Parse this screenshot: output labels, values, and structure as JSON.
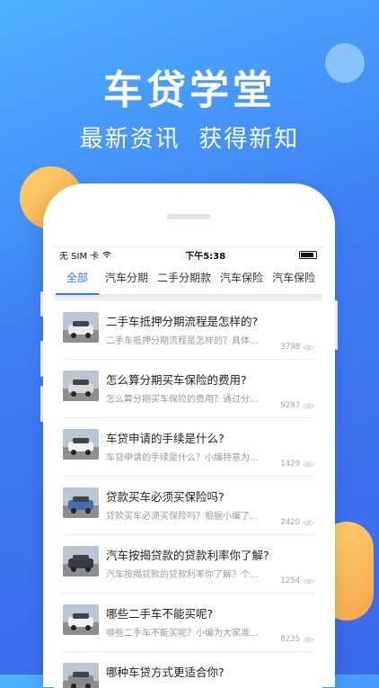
{
  "hero": {
    "title": "车贷学堂",
    "subtitle": "最新资讯  获得新知"
  },
  "status_bar": {
    "carrier": "无 SIM 卡",
    "time": "下午5:38"
  },
  "tabs": [
    {
      "label": "全部",
      "active": true
    },
    {
      "label": "汽车分期",
      "active": false
    },
    {
      "label": "二手分期款",
      "active": false
    },
    {
      "label": "汽车保险",
      "active": false
    },
    {
      "label": "汽车保险",
      "active": false
    }
  ],
  "articles": [
    {
      "title": "二手车抵押分期流程是怎样的?",
      "excerpt": "二手车抵押分期流程是怎样的？具体...",
      "views": "3798",
      "car_color": "#e9e9e9"
    },
    {
      "title": "怎么算分期买车保险的费用?",
      "excerpt": "怎么算分期买车保险的费用？通过分...",
      "views": "9297",
      "car_color": "#d9d9d9"
    },
    {
      "title": "车贷申请的手续是什么?",
      "excerpt": "车贷申请的手续是什么？小编特意为...",
      "views": "1429",
      "car_color": "#f2f2f2"
    },
    {
      "title": "贷款买车必须买保险吗?",
      "excerpt": "贷款买车必须买保险吗？根据小编了...",
      "views": "2420",
      "car_color": "#3f6ea8"
    },
    {
      "title": "汽车按揭贷款的贷款利率你了解?",
      "excerpt": "汽车按揭贷款的贷款利率你了解？个...",
      "views": "1254",
      "car_color": "#3a3a3a"
    },
    {
      "title": "哪些二手车不能买呢?",
      "excerpt": "哪些二手车不能买呢？小编为大家准...",
      "views": "8235",
      "car_color": "#f4f4f4"
    },
    {
      "title": "哪种车贷方式更适合你?",
      "excerpt": "",
      "views": "",
      "car_color": "#888888"
    }
  ],
  "colors": {
    "accent": "#2f7cf6",
    "bg_top": "#4fb1ff",
    "bg_bottom": "#3a69ea"
  }
}
